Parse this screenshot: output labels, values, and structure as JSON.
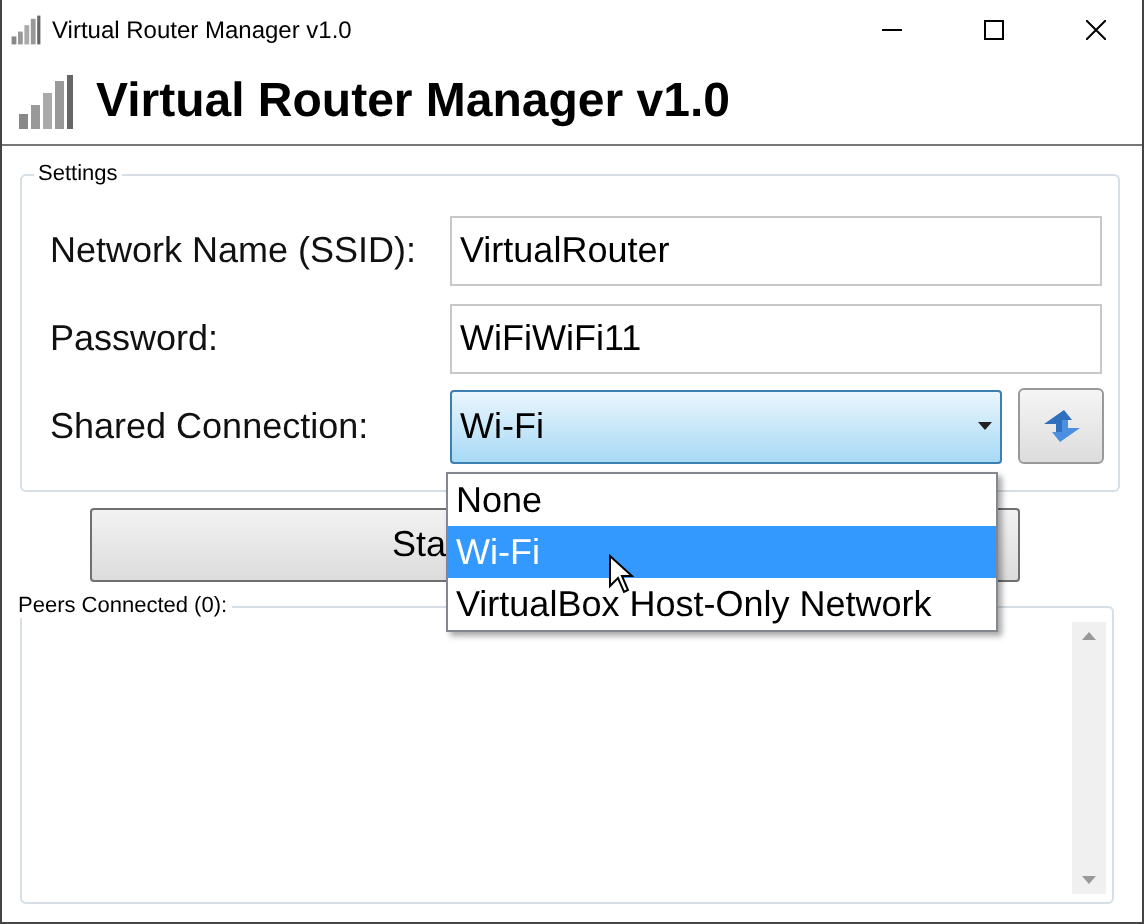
{
  "window": {
    "title": "Virtual Router Manager v1.0"
  },
  "header": {
    "title": "Virtual Router Manager v1.0"
  },
  "settings": {
    "legend": "Settings",
    "fields": [
      {
        "label": "Network Name (SSID):",
        "value": "VirtualRouter"
      },
      {
        "label": "Password:",
        "value": "WiFiWiFi11"
      }
    ],
    "shared_connection": {
      "label": "Shared Connection:",
      "value": "Wi-Fi",
      "expanded": true,
      "options": [
        {
          "label": "None",
          "selected": false
        },
        {
          "label": "Wi-Fi",
          "selected": true
        },
        {
          "label": "VirtualBox Host-Only Network",
          "selected": false
        }
      ]
    }
  },
  "start_button": {
    "label": "Sta"
  },
  "peers": {
    "legend": "Peers Connected (0):"
  }
}
